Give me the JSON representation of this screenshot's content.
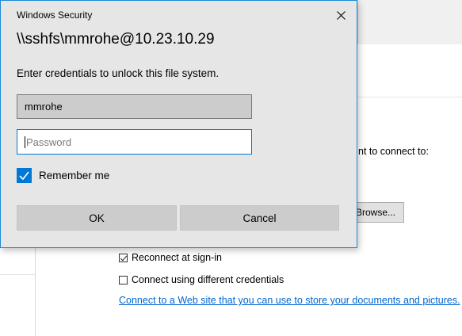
{
  "dialog": {
    "title": "Windows Security",
    "heading": "\\\\sshfs\\mmrohe@10.23.10.29",
    "subtitle": "Enter credentials to unlock this file system.",
    "username_value": "mmrohe",
    "password_placeholder": "Password",
    "remember_label": "Remember me",
    "remember_checked": true,
    "ok_label": "OK",
    "cancel_label": "Cancel",
    "accent_color": "#0078d7"
  },
  "background": {
    "connect_prompt_fragment": "nt to connect to:",
    "browse_label": "Browse...",
    "reconnect_label": "Reconnect at sign-in",
    "reconnect_checked": true,
    "different_credentials_label": "Connect using different credentials",
    "different_credentials_checked": false,
    "web_link": "Connect to a Web site that you can use to store your documents and pictures.",
    "link_color": "#0066cc"
  }
}
